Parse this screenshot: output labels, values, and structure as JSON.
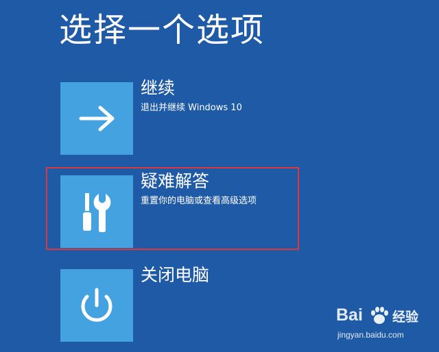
{
  "page": {
    "title": "选择一个选项"
  },
  "options": [
    {
      "title": "继续",
      "description": "退出并继续 Windows 10",
      "icon": "arrow-right-icon"
    },
    {
      "title": "疑难解答",
      "description": "重置你的电脑或查看高级选项",
      "icon": "tools-icon"
    },
    {
      "title": "关闭电脑",
      "description": "",
      "icon": "power-icon"
    }
  ],
  "colors": {
    "background": "#1f5aa6",
    "tile": "#45a2e0",
    "highlight": "#e0363d",
    "text": "#ffffff"
  },
  "watermark": {
    "logo_text_left": "Bai",
    "logo_text_cn": "经验",
    "url": "jingyan.baidu.com"
  }
}
